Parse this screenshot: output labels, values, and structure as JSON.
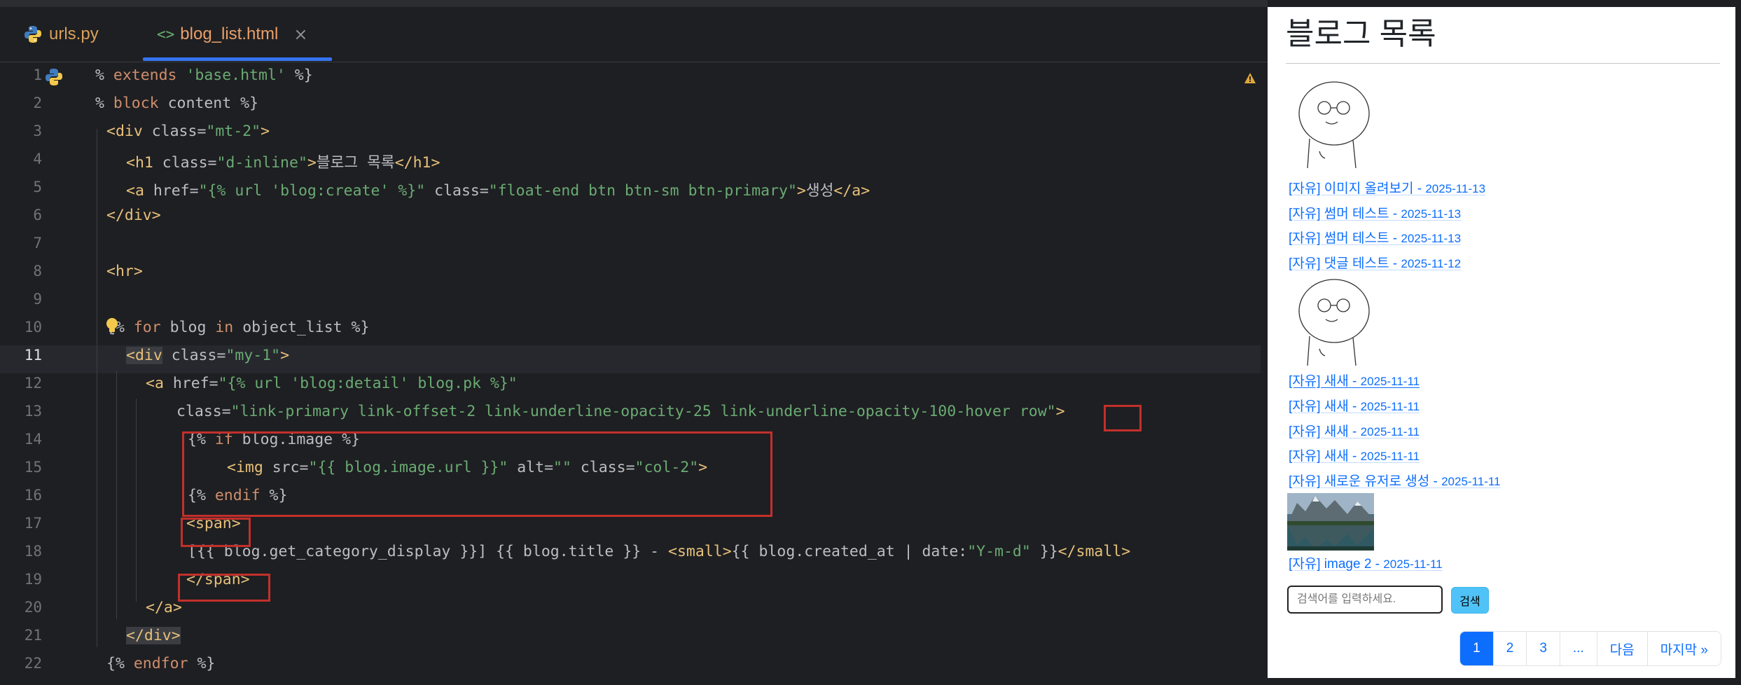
{
  "ide": {
    "tabs": [
      {
        "label": "urls.py",
        "icon": "python-icon"
      },
      {
        "label": "blog_list.html",
        "icon": "html-tag-icon",
        "active": true
      }
    ],
    "line_numbers": [
      "1",
      "2",
      "3",
      "4",
      "5",
      "6",
      "7",
      "8",
      "9",
      "10",
      "11",
      "12",
      "13",
      "14",
      "15",
      "16",
      "17",
      "18",
      "19",
      "20",
      "21",
      "22"
    ],
    "active_line": "11",
    "code": {
      "l1": {
        "a": "% ",
        "b": "extends",
        "c": " ",
        "d": "'base.html'",
        "e": " %}"
      },
      "l2": {
        "a": "% ",
        "b": "block",
        "c": " content %}"
      },
      "l3": {
        "a": "<div",
        "b": " class=",
        "c": "\"mt-2\"",
        "d": ">"
      },
      "l4": {
        "a": "<h1",
        "b": " class=",
        "c": "\"d-inline\"",
        "d": ">",
        "e": "블로그 목록",
        "f": "</h1>"
      },
      "l5": {
        "a": "<a",
        "b": " href=",
        "c": "\"{% url ",
        "d": "'blog:create'",
        "e": " %}\"",
        "f": " class=",
        "g": "\"float-end btn btn-sm btn-primary\"",
        "h": ">",
        "i": "생성",
        "j": "</a>"
      },
      "l6": {
        "a": "</div>"
      },
      "l8": {
        "a": "<hr>"
      },
      "l10": {
        "a": "{% ",
        "b": "for",
        "c": " blog ",
        "d": "in",
        "e": " object_list %}"
      },
      "l11": {
        "a": "<div",
        "b": " class=",
        "c": "\"my-1\"",
        "d": ">"
      },
      "l12": {
        "a": "<a",
        "b": " href=",
        "c": "\"{% url ",
        "d": "'blog:detail'",
        "e": " blog.pk %}\""
      },
      "l13": {
        "a": "class=",
        "b": "\"link-primary link-offset-2 link-underline-opacity-25 link-underline-opacity-100-hover ",
        "c": "row",
        "d": "\"",
        "e": ">"
      },
      "l14": {
        "a": "{% ",
        "b": "if",
        "c": " blog.image %}"
      },
      "l15": {
        "a": "<img",
        "b": " src=",
        "c": "\"{{ blog.image.url }}\"",
        "d": " alt=",
        "e": "\"\"",
        "f": " class=",
        "g": "\"col-2\"",
        "h": ">"
      },
      "l16": {
        "a": "{% ",
        "b": "endif",
        "c": " %}"
      },
      "l17": {
        "a": "<span>"
      },
      "l18": {
        "a": "[{{ blog.get_category_display }}] {{ blog.title }} - ",
        "b": "<small>",
        "c": "{{ blog.created_at | date:",
        "d": "\"Y-m-d\"",
        "e": " }}",
        "f": "</small>"
      },
      "l19": {
        "a": "</span>"
      },
      "l20": {
        "a": "</a>"
      },
      "l21": {
        "a": "</div>"
      },
      "l22": {
        "a": "{% ",
        "b": "endfor",
        "c": " %}"
      }
    }
  },
  "preview": {
    "title": "블로그 목록",
    "posts": [
      {
        "title": "[자유] 이미지 올려보기 - ",
        "date": "2025-11-13",
        "image": "doodle-person"
      },
      {
        "title": "[자유] 썸머 테스트 - ",
        "date": "2025-11-13"
      },
      {
        "title": "[자유] 썸머 테스트 - ",
        "date": "2025-11-13"
      },
      {
        "title": "[자유] 댓글 테스트 - ",
        "date": "2025-11-12"
      },
      {
        "title": "[자유] 새새 - ",
        "date": "2025-11-11",
        "image": "doodle-person",
        "hovered": true
      },
      {
        "title": "[자유] 새새 - ",
        "date": "2025-11-11"
      },
      {
        "title": "[자유] 새새 - ",
        "date": "2025-11-11"
      },
      {
        "title": "[자유] 새새 - ",
        "date": "2025-11-11"
      },
      {
        "title": "[자유] 새로운 유저로 생성 - ",
        "date": "2025-11-11"
      },
      {
        "title": "[자유] image 2 - ",
        "date": "2025-11-11",
        "image": "mountain-lake-photo"
      }
    ],
    "search": {
      "placeholder": "검색어를 입력하세요.",
      "button": "검색"
    },
    "pagination": {
      "pages": [
        "1",
        "2",
        "3",
        "..."
      ],
      "next": "다음",
      "last": "마지막 »",
      "active": "1"
    }
  }
}
